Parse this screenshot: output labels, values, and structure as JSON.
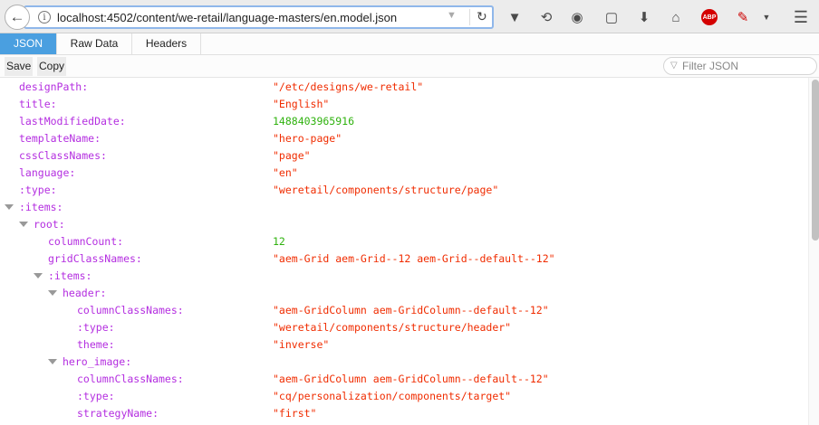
{
  "browser": {
    "url": "localhost:4502/content/we-retail/language-masters/en.model.json"
  },
  "tabs": [
    {
      "label": "JSON"
    },
    {
      "label": "Raw Data"
    },
    {
      "label": "Headers"
    }
  ],
  "toolbar": {
    "save_label": "Save",
    "copy_label": "Copy",
    "filter_placeholder": "Filter JSON"
  },
  "rows": [
    {
      "key": "designPath:",
      "value": "\"/etc/designs/we-retail\"",
      "type": "str",
      "level": 0
    },
    {
      "key": "title:",
      "value": "\"English\"",
      "type": "str",
      "level": 0
    },
    {
      "key": "lastModifiedDate:",
      "value": "1488403965916",
      "type": "num",
      "level": 0
    },
    {
      "key": "templateName:",
      "value": "\"hero-page\"",
      "type": "str",
      "level": 0
    },
    {
      "key": "cssClassNames:",
      "value": "\"page\"",
      "type": "str",
      "level": 0
    },
    {
      "key": "language:",
      "value": "\"en\"",
      "type": "str",
      "level": 0
    },
    {
      "key": ":type:",
      "value": "\"weretail/components/structure/page\"",
      "type": "str",
      "level": 0
    },
    {
      "key": ":items:",
      "value": "",
      "type": "obj",
      "level": 0
    },
    {
      "key": "root:",
      "value": "",
      "type": "obj",
      "level": 1
    },
    {
      "key": "columnCount:",
      "value": "12",
      "type": "num",
      "level": 2
    },
    {
      "key": "gridClassNames:",
      "value": "\"aem-Grid aem-Grid--12 aem-Grid--default--12\"",
      "type": "str",
      "level": 2
    },
    {
      "key": ":items:",
      "value": "",
      "type": "obj",
      "level": 2
    },
    {
      "key": "header:",
      "value": "",
      "type": "obj",
      "level": 3
    },
    {
      "key": "columnClassNames:",
      "value": "\"aem-GridColumn aem-GridColumn--default--12\"",
      "type": "str",
      "level": 4
    },
    {
      "key": ":type:",
      "value": "\"weretail/components/structure/header\"",
      "type": "str",
      "level": 4
    },
    {
      "key": "theme:",
      "value": "\"inverse\"",
      "type": "str",
      "level": 4
    },
    {
      "key": "hero_image:",
      "value": "",
      "type": "obj",
      "level": 3
    },
    {
      "key": "columnClassNames:",
      "value": "\"aem-GridColumn aem-GridColumn--default--12\"",
      "type": "str",
      "level": 4
    },
    {
      "key": ":type:",
      "value": "\"cq/personalization/components/target\"",
      "type": "str",
      "level": 4
    },
    {
      "key": "strategyName:",
      "value": "\"first\"",
      "type": "str",
      "level": 4
    }
  ]
}
